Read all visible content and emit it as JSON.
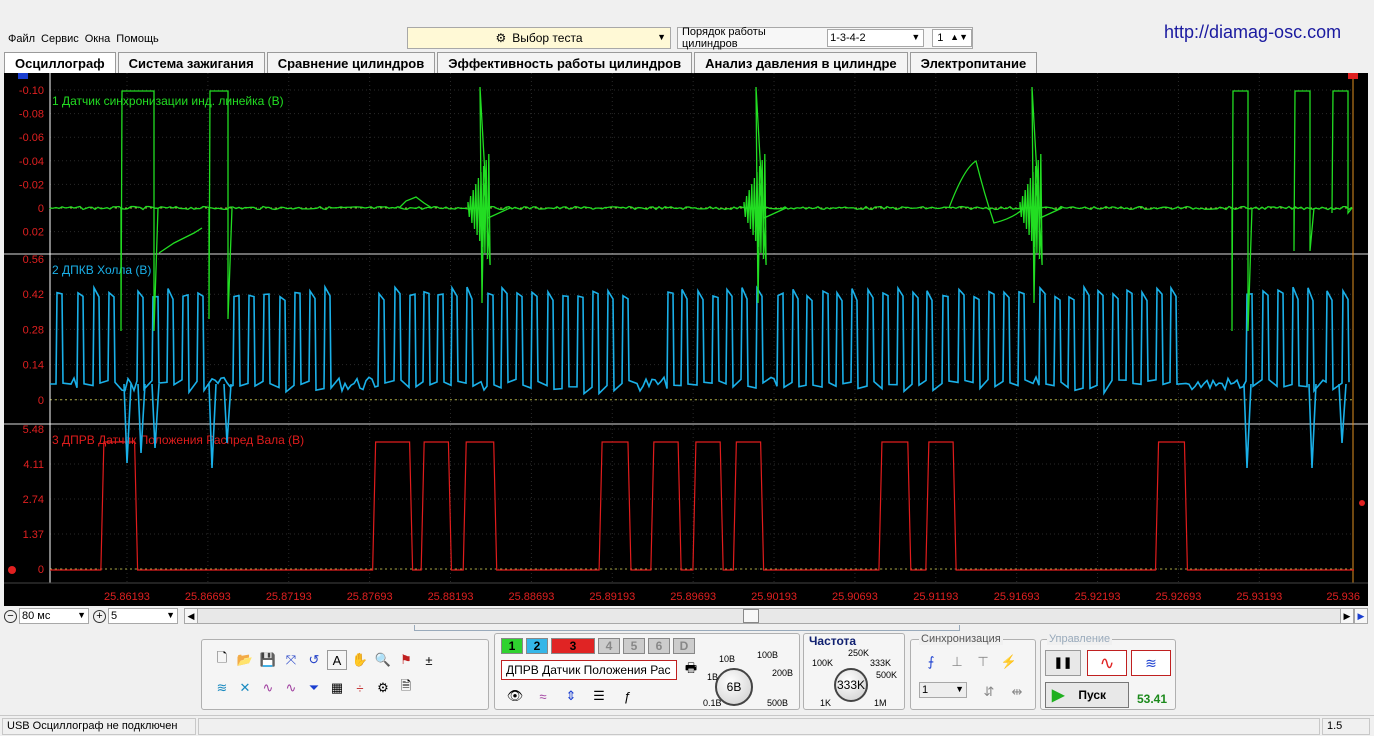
{
  "menu": [
    "Файл",
    "Сервис",
    "Окна",
    "Помощь"
  ],
  "test_select": {
    "label": "Выбор теста"
  },
  "cylinder_order": {
    "label": "Порядок работы цилиндров",
    "value": "1-3-4-2",
    "spin": "1"
  },
  "site_url": "http://diamag-osc.com",
  "tabs": [
    {
      "label": "Осциллограф",
      "active": true
    },
    {
      "label": "Система зажигания"
    },
    {
      "label": "Сравнение цилиндров"
    },
    {
      "label": "Эффективность работы цилиндров"
    },
    {
      "label": "Анализ давления в цилиндре"
    },
    {
      "label": "Электропитание"
    }
  ],
  "chart_data": {
    "type": "line",
    "channels": [
      {
        "name": "1 Датчик синхронизации инд. линейка (В)",
        "color": "#22dd22",
        "ticks": [
          "-0.10",
          "-0.08",
          "-0.06",
          "-0.04",
          "-0.02",
          "0",
          "0.02"
        ]
      },
      {
        "name": "2 ДПКВ Холла (В)",
        "color": "#1ab0e8",
        "ticks": [
          "0.56",
          "0.42",
          "0.28",
          "0.14",
          "0"
        ]
      },
      {
        "name": "3 ДПРВ Датчик Положения Распред Вала (В)",
        "color": "#e01c1c",
        "ticks": [
          "5.48",
          "4.11",
          "2.74",
          "1.37",
          "0"
        ]
      }
    ],
    "x_ticks": [
      "25.86193",
      "25.86693",
      "25.87193",
      "25.87693",
      "25.88193",
      "25.88693",
      "25.89193",
      "25.89693",
      "25.90193",
      "25.90693",
      "25.91193",
      "25.91693",
      "25.92193",
      "25.92693",
      "25.93193",
      "25.936"
    ],
    "red_high_segments": [
      [
        25.8605,
        25.8624
      ],
      [
        25.8773,
        25.8794
      ],
      [
        25.8803,
        25.8818
      ],
      [
        25.8829,
        25.8846
      ],
      [
        25.8913,
        25.8929
      ],
      [
        25.8945,
        25.896
      ],
      [
        25.8971,
        25.8986
      ],
      [
        25.8996,
        25.9011
      ],
      [
        25.9086,
        25.9102
      ],
      [
        25.9115,
        25.913
      ],
      [
        25.9257,
        25.9273
      ]
    ],
    "grid": true
  },
  "timebase": {
    "value": "80 мс",
    "zoom": "5"
  },
  "toolbar": {
    "channel_buttons": [
      "1",
      "2",
      "3",
      "4",
      "5",
      "6",
      "D"
    ],
    "channel_select": "ДПРВ Датчик Положения Рас",
    "volt_knob": {
      "value": "6В",
      "labels": [
        "10В",
        "100В",
        "1В",
        "200В",
        "0.1В",
        "500В"
      ]
    },
    "freq": {
      "title": "Частота",
      "value": "333K",
      "labels": [
        "250K",
        "100K",
        "333K",
        "500K",
        "1K",
        "1M"
      ]
    },
    "sync": {
      "title": "Синхронизация",
      "value": "1"
    },
    "control": {
      "title": "Управление",
      "start_label": "Пуск",
      "fps": "53.41"
    }
  },
  "status": {
    "text": "USB Осциллограф не подключен",
    "right": "1.5"
  }
}
